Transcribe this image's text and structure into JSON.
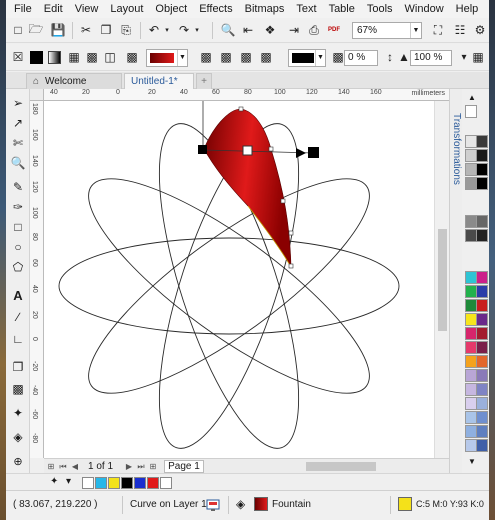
{
  "menu": [
    "File",
    "Edit",
    "View",
    "Layout",
    "Object",
    "Effects",
    "Bitmaps",
    "Text",
    "Table",
    "Tools",
    "Window",
    "Help"
  ],
  "toolbar": {
    "zoom": "67%",
    "pdf_label": "PDF",
    "outline_width": "0 %",
    "opacity": "100 %"
  },
  "tabs": {
    "welcome": "Welcome Screen",
    "document": "Untitled-1*",
    "add": "+"
  },
  "rulers": {
    "units": "millimeters",
    "top_ticks": [
      "40",
      "20",
      "0",
      "20",
      "40",
      "60",
      "80",
      "100",
      "120",
      "140",
      "160",
      "180"
    ],
    "left_ticks": [
      "180",
      "160",
      "140",
      "120",
      "100",
      "80",
      "60",
      "40",
      "20",
      "0",
      "-20",
      "-40",
      "-60",
      "-80"
    ]
  },
  "dockers": {
    "transformations": "Transformations"
  },
  "page_nav": {
    "current": "1",
    "of_label": "of",
    "total": "1",
    "page_tab": "Page 1"
  },
  "status": {
    "coords": "( 83.067, 219.220 )",
    "layer": "Curve on Layer 1",
    "fill": "Fountain",
    "cmyk": "C:5 M:0 Y:93 K:0"
  },
  "colors": {
    "accent": "#2a5a9a",
    "petal_dark": "#7a0000",
    "petal_light": "#e01a1a",
    "status_fill": "#f4e11a"
  },
  "icons": {
    "pick": "arrow-pointer-icon",
    "shape": "shape-node-icon",
    "crop": "crop-icon",
    "zoom": "zoom-icon",
    "freehand": "freehand-icon",
    "artistic": "artistic-media-icon",
    "rectangle": "rectangle-icon",
    "ellipse": "ellipse-icon",
    "polygon": "polygon-icon",
    "text": "text-icon",
    "parallel": "parallel-dimension-icon",
    "connector": "connector-icon",
    "shadow": "drop-shadow-icon",
    "transparency": "transparency-icon",
    "eyedropper": "eyedropper-icon",
    "fill": "interactive-fill-icon"
  }
}
